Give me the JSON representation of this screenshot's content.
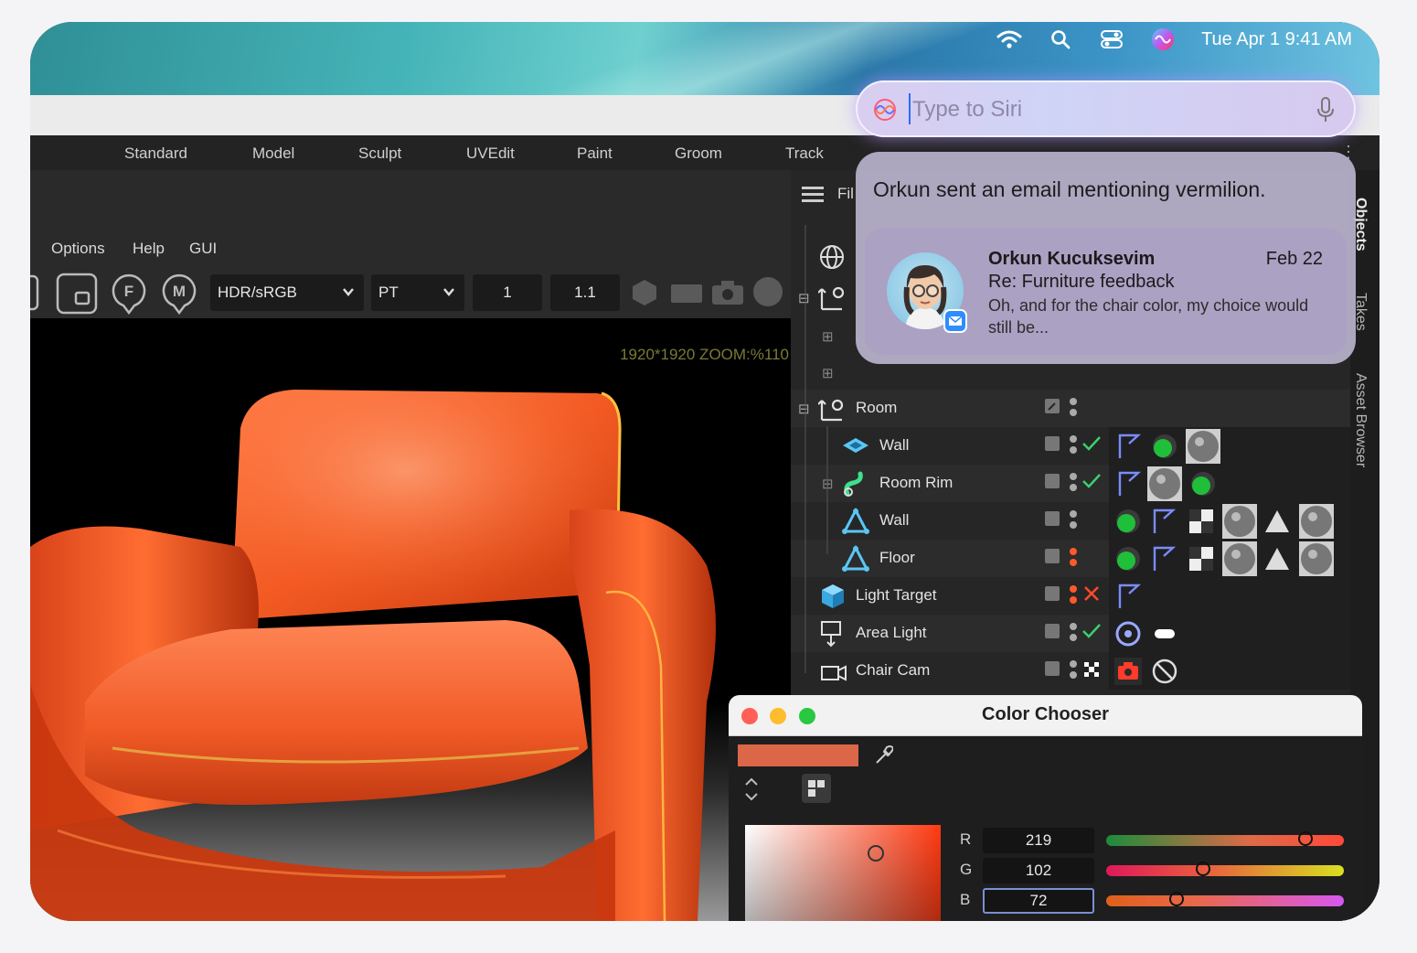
{
  "menubar": {
    "datetime": "Tue Apr 1  9:41 AM"
  },
  "workspace_tabs": [
    "Standard",
    "Model",
    "Sculpt",
    "UVEdit",
    "Paint",
    "Groom",
    "Track"
  ],
  "viewport_menu": [
    "Options",
    "Help",
    "GUI"
  ],
  "toolbar": {
    "color_space": "HDR/sRGB",
    "display": "PT",
    "value1": "1",
    "value2": "1.1"
  },
  "viewport": {
    "zoom_label": "1920*1920 ZOOM:%110"
  },
  "object_manager": {
    "file_menu": "Fil",
    "rows": [
      {
        "name": "Room"
      },
      {
        "name": "Wall"
      },
      {
        "name": "Room Rim"
      },
      {
        "name": "Wall"
      },
      {
        "name": "Floor"
      },
      {
        "name": "Light Target"
      },
      {
        "name": "Area Light"
      },
      {
        "name": "Chair Cam"
      }
    ]
  },
  "side_tabs": [
    "Objects",
    "Takes",
    "Asset Browser"
  ],
  "siri": {
    "placeholder": "Type to Siri"
  },
  "notification": {
    "title": "Orkun sent an email mentioning vermilion.",
    "sender": "Orkun Kucuksevim",
    "date": "Feb 22",
    "subject": "Re: Furniture feedback",
    "preview": "Oh, and for the chair color, my choice would still be..."
  },
  "color_chooser": {
    "title": "Color Chooser",
    "swatch_color": "#db6648",
    "channels": [
      {
        "label": "R",
        "value": "219"
      },
      {
        "label": "G",
        "value": "102"
      },
      {
        "label": "B",
        "value": "72"
      }
    ]
  },
  "colors": {
    "chair": "#ff5a1f",
    "accent_check": "#3bd16f",
    "cross": "#ff4a2a"
  }
}
